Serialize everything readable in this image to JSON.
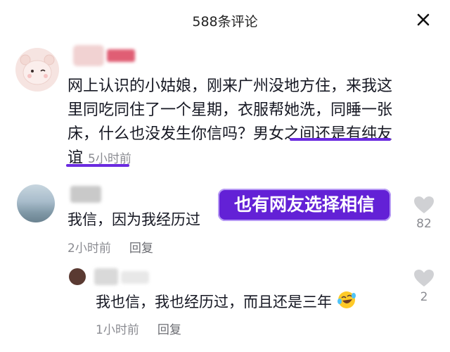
{
  "header": {
    "title": "588条评论"
  },
  "comment1": {
    "text_before": "网上认识的小姑娘，刚来广州没地方住，来我这里同吃同住了一个星期，衣服帮她洗，同睡一张床，什么也没发生你信吗？",
    "text_highlight": "男女之间还是有纯友谊",
    "time": "5小时前"
  },
  "comment2": {
    "text": "我信，因为我经历过",
    "time": "2小时前",
    "reply_label": "回复",
    "likes": "82"
  },
  "comment3": {
    "text": "我也信，我也经历过，而且还是三年",
    "time": "1小时前",
    "reply_label": "回复",
    "likes": "2"
  },
  "caption": "也有网友选择相信",
  "icons": {
    "close": "close-icon",
    "like": "heart-icon",
    "emoji": "laughing-tears-emoji-icon"
  },
  "colors": {
    "highlight_underline": "#6b2be0",
    "caption_bg": "#6321d6",
    "meta_text": "#8a8b91"
  }
}
